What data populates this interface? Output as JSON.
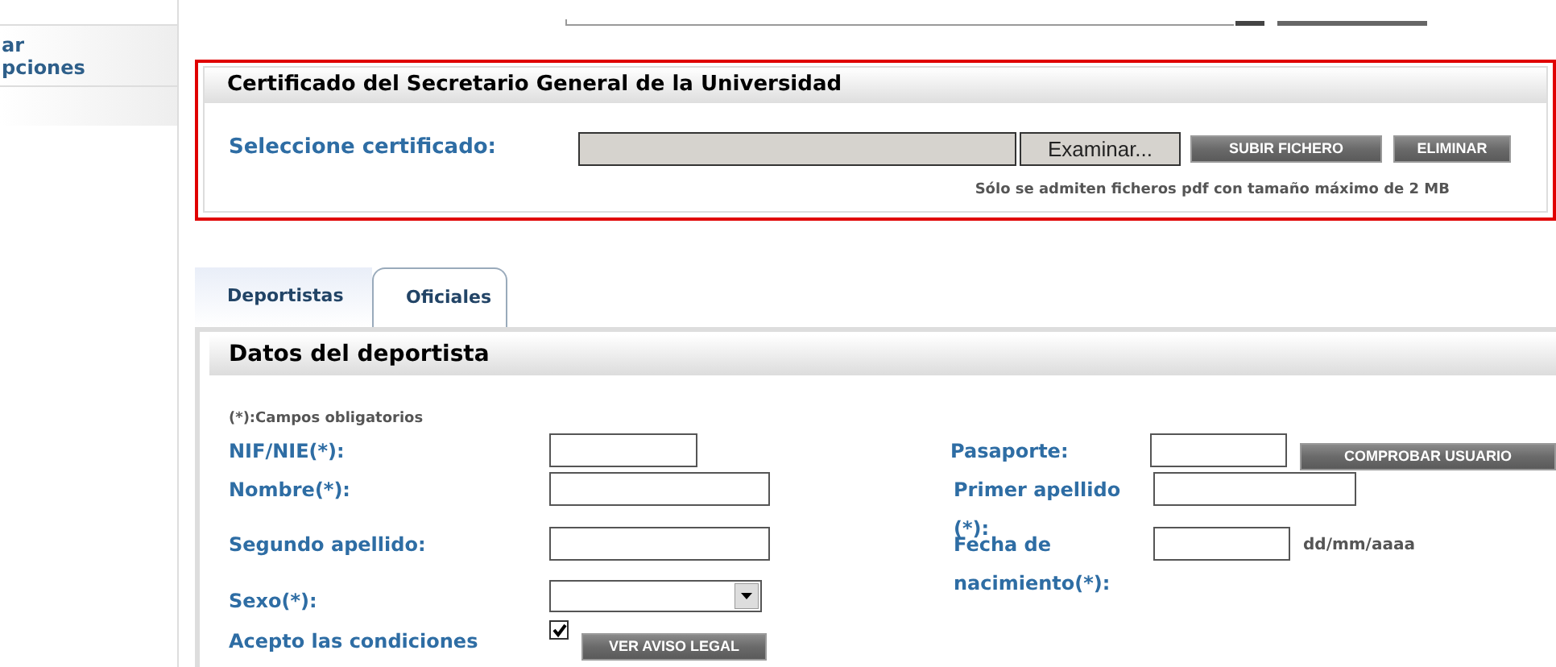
{
  "sidebar": {
    "items": [
      {
        "label": "ar\npciones"
      }
    ]
  },
  "certificate": {
    "title": "Certificado del Secretario General de la Universidad",
    "label": "Seleccione certificado:",
    "browse_button": "Examinar...",
    "buttons": [
      "SUBIR FICHERO",
      "ELIMINAR"
    ],
    "note": "Sólo se admiten ficheros pdf con tamaño máximo de 2 MB"
  },
  "tabs": [
    {
      "label": "Deportistas",
      "selected": true
    },
    {
      "label": "Oficiales",
      "selected": false
    }
  ],
  "panel": {
    "title": "Datos del deportista",
    "required_note": "(*):Campos obligatorios",
    "rows": [
      [
        {
          "label": "NIF/NIE(*):",
          "kind": "text"
        },
        {
          "label": "Pasaporte:",
          "kind": "text",
          "button": "COMPROBAR USUARIO"
        }
      ],
      [
        {
          "label": "Nombre(*):",
          "kind": "text"
        },
        {
          "label": "Primer apellido (*):",
          "kind": "text"
        }
      ],
      [
        {
          "label": "Segundo apellido:",
          "kind": "text"
        },
        {
          "label": "Fecha de nacimiento(*):",
          "kind": "text",
          "hint": "dd/mm/aaaa"
        }
      ],
      [
        {
          "label": "Sexo(*):",
          "kind": "select"
        }
      ],
      [
        {
          "label": "Acepto las condiciones",
          "kind": "checkbox",
          "checked": true,
          "button": "VER AVISO LEGAL"
        }
      ]
    ]
  }
}
